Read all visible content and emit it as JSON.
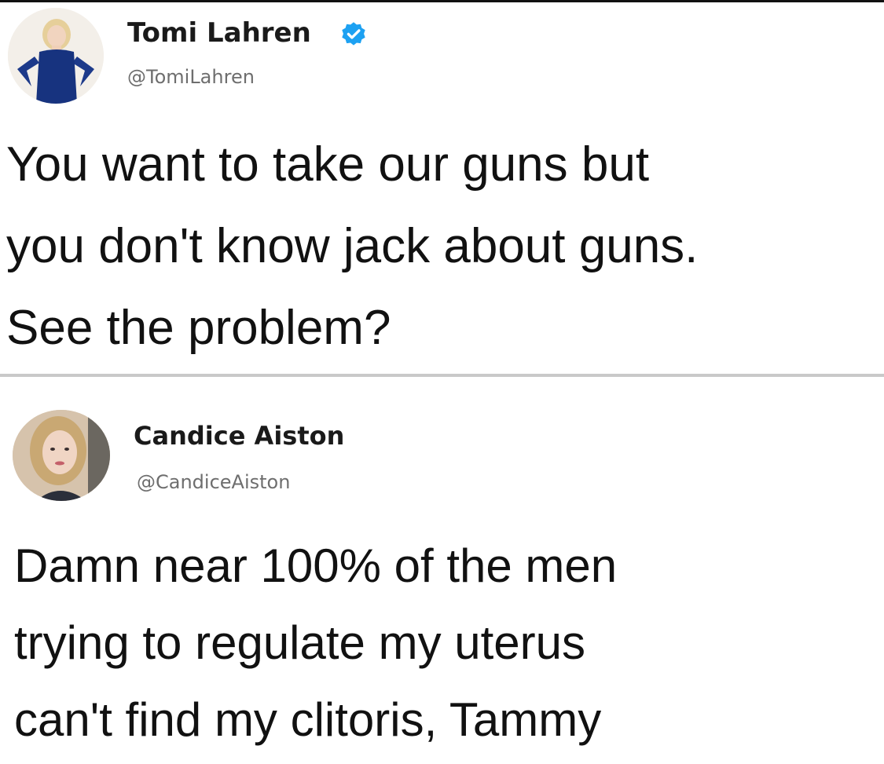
{
  "tweets": [
    {
      "display_name": "Tomi Lahren",
      "handle": "@TomiLahren",
      "verified": true,
      "text": "You want to take our guns but\nyou don't know jack about guns.\nSee the problem?"
    },
    {
      "display_name": "Candice Aiston",
      "handle": "@CandiceAiston",
      "verified": false,
      "text": "Damn near 100% of the men\ntrying to regulate my uterus\ncan't find my clitoris, Tammy"
    }
  ],
  "colors": {
    "verified_badge": "#1da1f2",
    "handle_text": "#6e6e6e",
    "divider": "#c9c9c9"
  }
}
